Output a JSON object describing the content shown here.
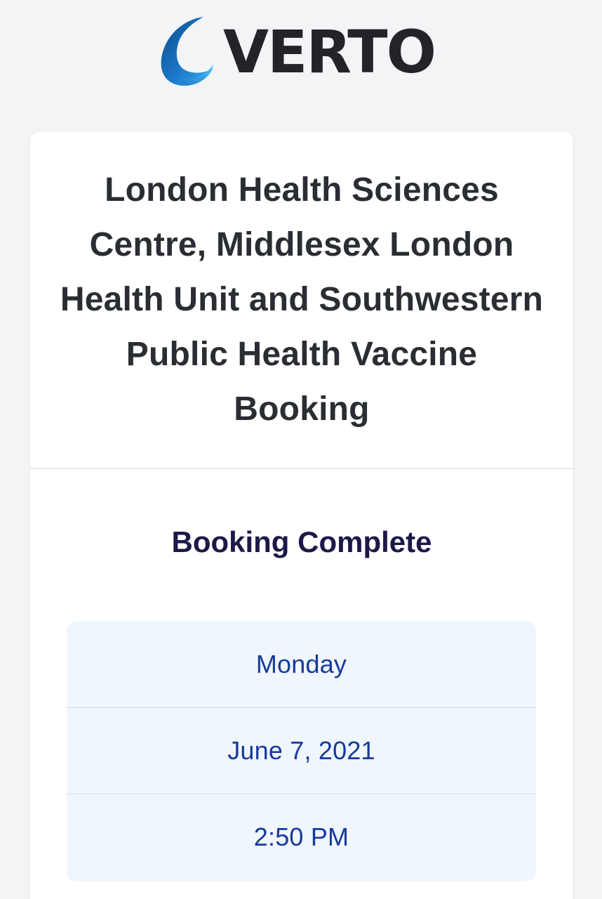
{
  "brand": {
    "name": "VERTO",
    "colors": {
      "mark_dark": "#0b4f86",
      "mark_mid": "#1b76c7",
      "mark_light": "#34b3f3",
      "word": "#222428"
    }
  },
  "booking": {
    "title": "London Health Sciences Centre, Middlesex London Health Unit and Southwestern Public Health Vaccine Booking",
    "status": "Booking Complete",
    "day": "Monday",
    "date": "June 7, 2021",
    "time": "2:50 PM"
  }
}
